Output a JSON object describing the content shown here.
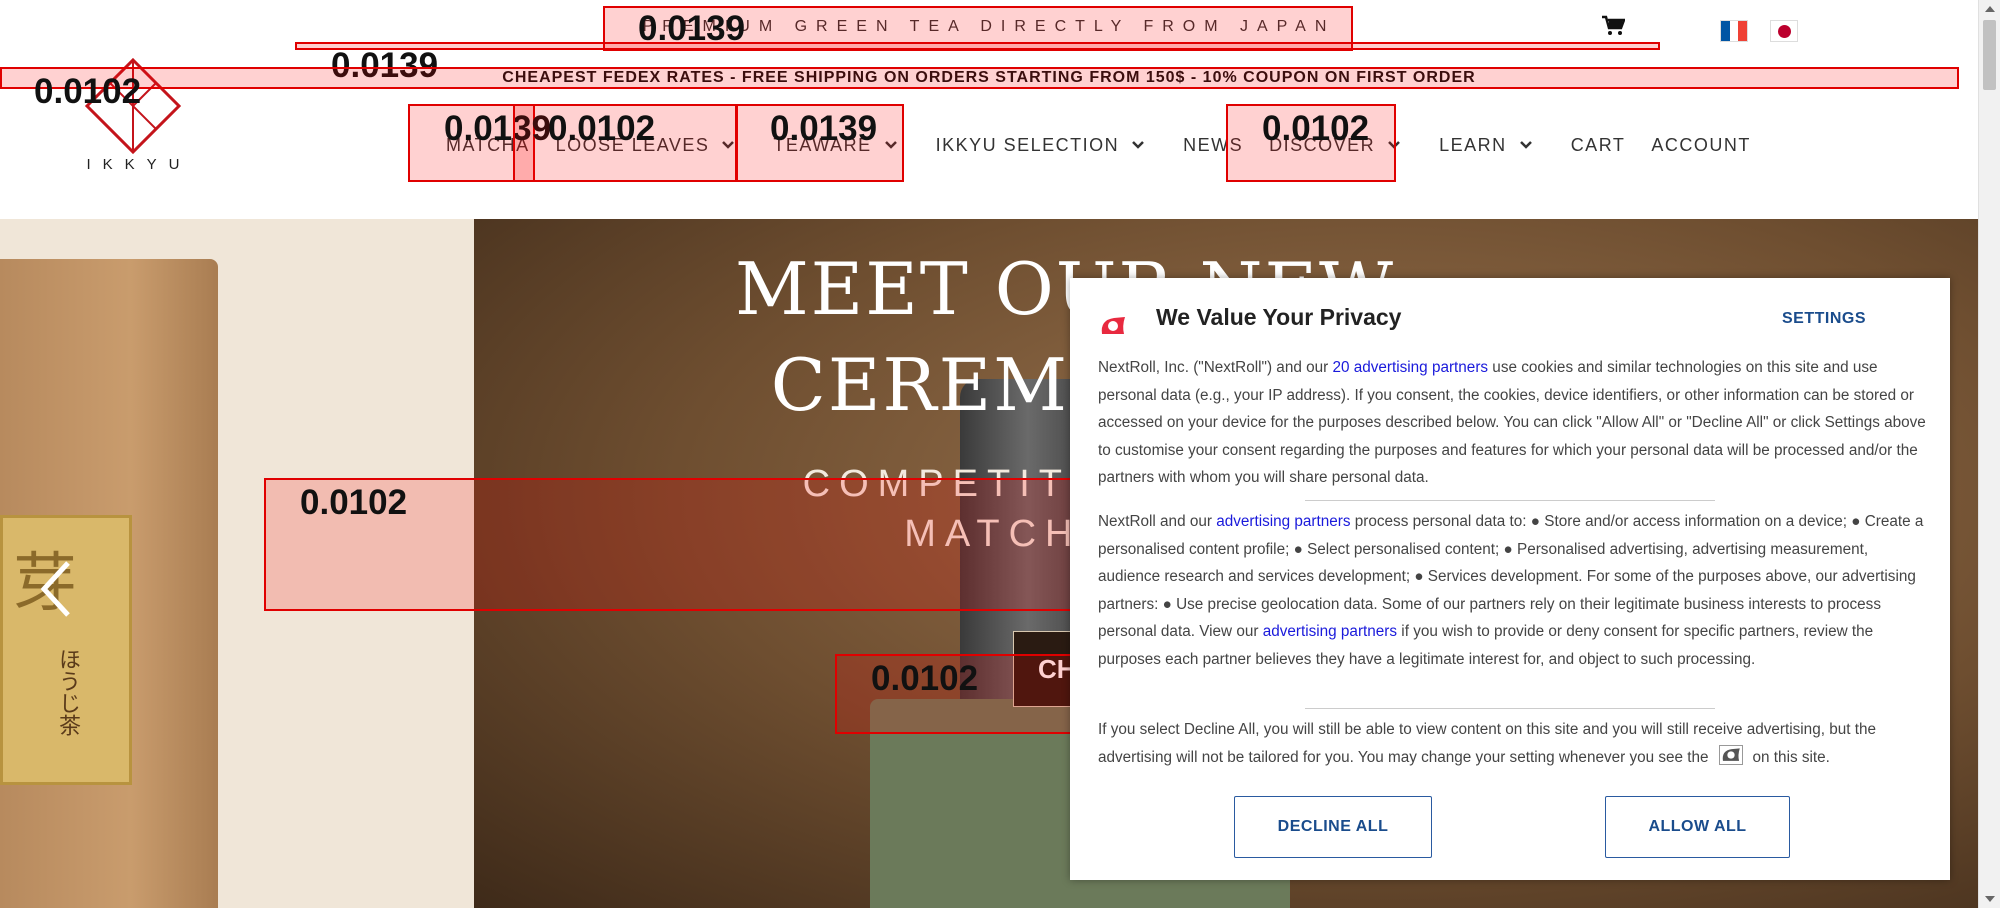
{
  "header": {
    "promo": "PREMIUM GREEN TEA DIRECTLY FROM JAPAN",
    "shipping": "CHEAPEST FEDEX RATES - FREE SHIPPING ON ORDERS STARTING FROM 150$ - 10% COUPON ON FIRST ORDER",
    "logo_text": "IKKYU",
    "icons": {
      "cart": "cart-icon",
      "flag_fr": "flag-france-icon",
      "flag_jp": "flag-japan-icon"
    }
  },
  "nav": [
    {
      "label": "MATCHA",
      "has_dropdown": false
    },
    {
      "label": "LOOSE LEAVES",
      "has_dropdown": true
    },
    {
      "label": "TEAWARE",
      "has_dropdown": true
    },
    {
      "label": "IKKYU SELECTION",
      "has_dropdown": true
    },
    {
      "label": "NEWS",
      "has_dropdown": false
    },
    {
      "label": "DISCOVER",
      "has_dropdown": true
    },
    {
      "label": "LEARN",
      "has_dropdown": true
    },
    {
      "label": "CART",
      "has_dropdown": false
    },
    {
      "label": "ACCOUNT",
      "has_dropdown": false
    }
  ],
  "hero": {
    "title_line1": "MEET OUR NEW",
    "title_line2": "CEREMONIAL",
    "subtitle_line1": "COMPETITION A",
    "subtitle_line2": "MATCHA",
    "button_label": "CH",
    "bag_kanji": "芽",
    "bag_text": "ほうじ茶"
  },
  "consent": {
    "title": "We Value Your Privacy",
    "settings": "SETTINGS",
    "p1_a": "NextRoll, Inc. (\"NextRoll\") and our ",
    "p1_link": "20 advertising partners",
    "p1_b": " use cookies and similar technologies on this site and use personal data (e.g., your IP address). If you consent, the cookies, device identifiers, or other information can be stored or accessed on your device for the purposes described below. You can click \"Allow All\" or \"Decline All\" or click Settings above to customise your consent regarding the purposes and features for which your personal data will be processed and/or the partners with whom you will share personal data.",
    "p2_a": "NextRoll and our ",
    "p2_link1": "advertising partners",
    "p2_b": " process personal data to: ● Store and/or access information on a device; ● Create a personalised content profile; ● Select personalised content; ● Personalised advertising, advertising measurement, audience research and services development; ● Services development. For some of the purposes above, our advertising partners: ● Use precise geolocation data. Some of our partners rely on their legitimate business interests to process personal data. View our ",
    "p2_link2": "advertising partners",
    "p2_c": " if you wish to provide or deny consent for specific partners, review the purposes each partner believes they have a legitimate interest for, and object to such processing.",
    "p3_a": "If you select Decline All, you will still be able to view content on this site and you will still receive advertising, but the advertising will not be tailored for you. You may change your setting whenever you see the",
    "p3_b": "on this site.",
    "decline": "DECLINE ALL",
    "allow": "ALLOW ALL"
  },
  "overlay_scores": [
    "0.0139",
    "0.0139",
    "0.0102",
    "0.0139",
    "0.0102",
    "0.0139",
    "0.0102",
    "0.0102",
    "0.0102"
  ]
}
